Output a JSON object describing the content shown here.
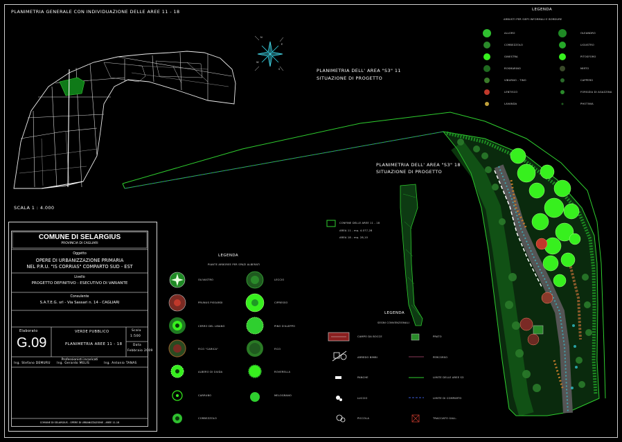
{
  "sheet": {
    "title_main": "PLANIMETRIA GENERALE CON INDIVIDUAZIONE DELLE AREE 11 - 18",
    "scale": "SCALA 1 : 4.000",
    "title_area11": "PLANIMETRIA DELL' AREA \"S3\" 11",
    "subtitle_area11": "SITUAZIONE DI PROGETTO",
    "title_area18": "PLANIMETRIA DELL' AREA \"S3\" 18",
    "subtitle_area18": "SITUAZIONE DI PROGETTO",
    "north_labels": [
      "N",
      "E",
      "S",
      "W"
    ]
  },
  "area_summary": {
    "label": "CONFINE DELLE AREE 11 - 18",
    "rows": [
      "AREA 11  -  mq.  4.077,28",
      "AREA 18  -  mq.  28,10"
    ]
  },
  "legend_top": {
    "title": "LEGENDA",
    "subtitle": "ARBUSTI PER SIEPI INFORMALI E BORDURE",
    "left": [
      "ALLORO",
      "CORBEZZOLO",
      "GINESTRA",
      "ROSMARINO",
      "VIBURNO - TINO",
      "LENTISCO",
      "LAVANDA"
    ],
    "right": [
      "OLEANDRO",
      "LIGUSTRO",
      "PITOSFORO",
      "MIRTO",
      "CAPPERO",
      "FORSIZIA DI AGAZZINA",
      "PHOTINIA"
    ]
  },
  "legend_trees": {
    "title": "LEGENDA",
    "subtitle": "PIANTE ARBOREE PER SPAZI ALBERATI",
    "left": [
      "OLIVASTRO",
      "PRUNUS PISSARDI",
      "CERRO DEL LIBANO",
      "FICO \"CARICA\"",
      "ALBERO DI GIUDA",
      "CARRUBO",
      "CORBEZZOLO"
    ],
    "right": [
      "LECCIO",
      "CIPRESSO",
      "PINO D'ALEPPO",
      "FICO",
      "ROVERELLA",
      "MELOGRANO"
    ]
  },
  "legend_symbols": {
    "title": "LEGENDA",
    "subtitle": "SEGNI CONVENZIONALI",
    "left": [
      "CAMPO DA BOCCE",
      "ARREDO BIMBI",
      "PANCHE",
      "LUCCIO",
      "PICCOLA"
    ],
    "right": [
      "PRATO",
      "PERCORSO",
      "LIMITE DELLE AREE S3",
      "LIMITE DI COMPARTO",
      "TRACCIATO GALL."
    ]
  },
  "title_block": {
    "municipality": "COMUNE DI SELARGIUS",
    "province": "PROVINCIA DI CAGLIARI",
    "object_label": "Oggetto",
    "object_line1": "OPERE DI URBANIZZAZIONE PRIMARIA",
    "object_line2": "NEL P.R.U. \"IS CORRIAS\" COMPARTO SUD - EST",
    "level_label": "Livello",
    "level_value": "PROGETTO DEFINITIVO - ESECUTIVO DI VARIANTE",
    "consultant_label": "Consulente",
    "consultant_value": "S.A.T.E.G. srl  -  Via Sassari n. 14  -  CAGLIARI",
    "drawing_label": "Elaborato",
    "drawing_number": "G.09",
    "category": "VERDE PUBBLICO",
    "drawing_title": "PLANIMETRIA AREE 11 - 18",
    "scale_label": "Scala",
    "scale_value": "1:500",
    "date_label": "Data",
    "date_value": "Febbraio 2009",
    "designers_label": "Professionisti incaricati",
    "designers": [
      "Ing. Stefano DEMURU",
      "Ing. Gerardo MELIS",
      "Ing. Antonio TANAS"
    ],
    "footer": "COMUNE DI SELARGIUS - OPERE DI URBANIZZAZIONE - AREE 11-18"
  },
  "colors": {
    "bright_green": "#37f01e",
    "mid_green": "#25a828",
    "dark_green": "#0f5a18",
    "boundary": "#2fcf2f",
    "red": "#c0392b",
    "brown": "#8a5a2b",
    "cyan": "#36d6e7",
    "white_line": "#e8e8e8"
  }
}
